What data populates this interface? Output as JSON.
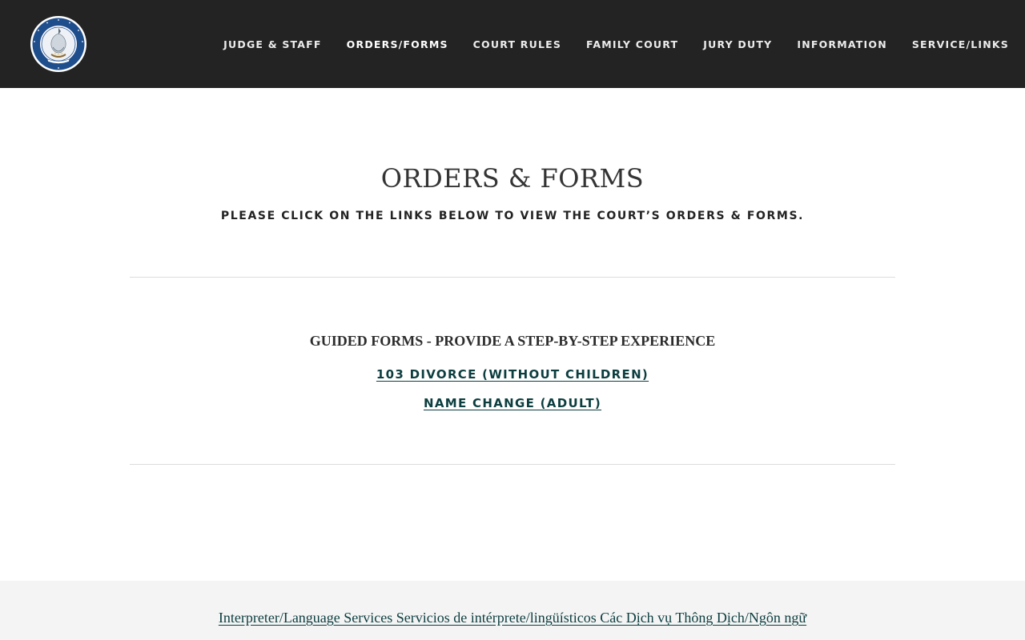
{
  "header": {
    "logo": {
      "icon": "louisiana-state-seal-icon",
      "seal_outer_text": "STATE OF LOUISIANA",
      "seal_motto": "UNION JUSTICE CONFIDENCE",
      "colors": {
        "ring": "#1f4e8c",
        "inner": "#ffffff",
        "background": "#232323"
      }
    },
    "nav": [
      {
        "label": "JUDGE & STAFF"
      },
      {
        "label": "ORDERS/FORMS"
      },
      {
        "label": "COURT RULES"
      },
      {
        "label": "FAMILY COURT"
      },
      {
        "label": "JURY DUTY"
      },
      {
        "label": "INFORMATION"
      },
      {
        "label": "SERVICE/LINKS"
      }
    ],
    "active_nav": "ORDERS/FORMS"
  },
  "main": {
    "title": "ORDERS & FORMS",
    "subtitle": "PLEASE CLICK ON THE LINKS BELOW TO VIEW THE COURT’S ORDERS & FORMS.",
    "section": {
      "heading_bold": "GUIDED FORMS -",
      "heading_rest": " PROVIDE A STEP-BY-STEP EXPERIENCE",
      "links": [
        {
          "label": "103 DIVORCE (WITHOUT CHILDREN)"
        },
        {
          "label": "NAME CHANGE (ADULT)"
        }
      ]
    }
  },
  "footer": {
    "language_link": "Interpreter/Language Services Servicios de intérprete/lingüísticos Các Dịch vụ Thông Dịch/Ngôn ngữ"
  },
  "colors": {
    "header_bg": "#232323",
    "link": "#0c3d3f",
    "footer_bg": "#f4f4f4",
    "divider": "#dcdcdc"
  }
}
